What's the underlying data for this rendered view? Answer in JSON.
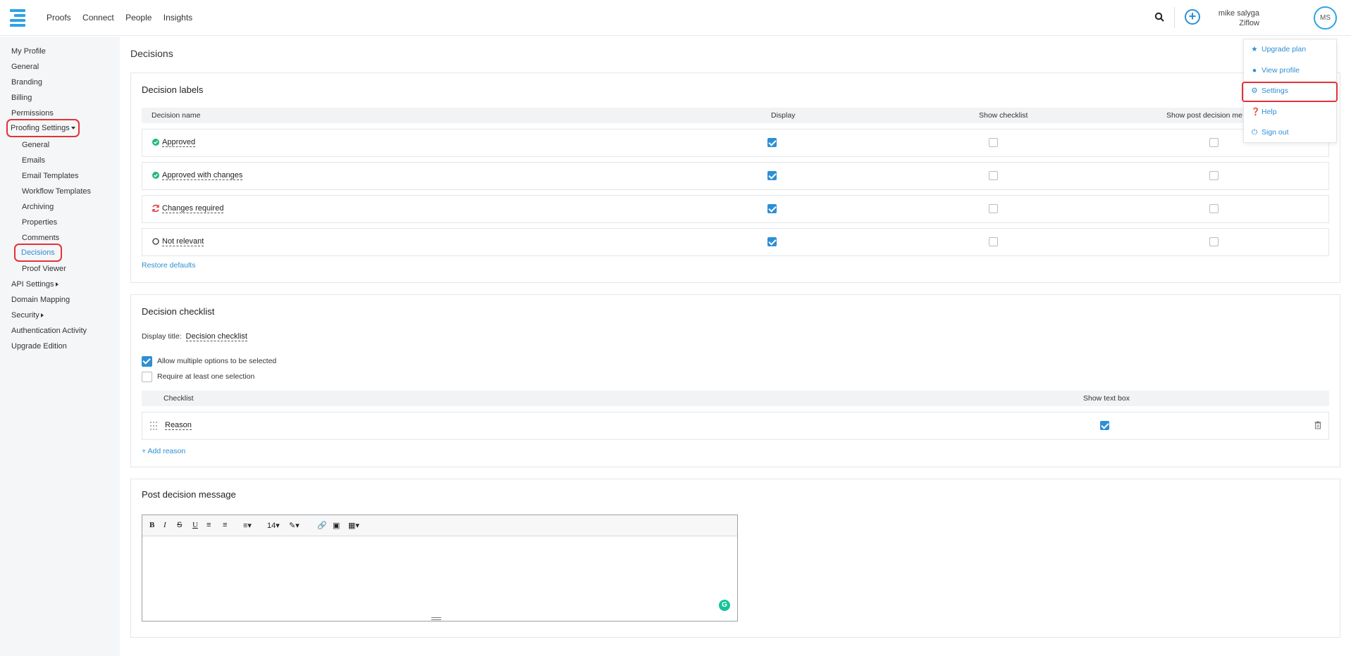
{
  "topnav": {
    "items": [
      "Proofs",
      "Connect",
      "People",
      "Insights"
    ]
  },
  "user": {
    "name": "mike salyga",
    "org": "Ziflow",
    "initials": "MS"
  },
  "sidebar": {
    "items": [
      {
        "label": "My Profile"
      },
      {
        "label": "General"
      },
      {
        "label": "Branding"
      },
      {
        "label": "Billing"
      },
      {
        "label": "Permissions"
      },
      {
        "label": "Proofing Settings"
      },
      {
        "label": "General"
      },
      {
        "label": "Emails"
      },
      {
        "label": "Email Templates"
      },
      {
        "label": "Workflow Templates"
      },
      {
        "label": "Archiving"
      },
      {
        "label": "Properties"
      },
      {
        "label": "Comments"
      },
      {
        "label": "Decisions"
      },
      {
        "label": "Proof Viewer"
      },
      {
        "label": "API Settings"
      },
      {
        "label": "Domain Mapping"
      },
      {
        "label": "Security"
      },
      {
        "label": "Authentication Activity"
      },
      {
        "label": "Upgrade Edition"
      }
    ]
  },
  "page": {
    "title": "Decisions"
  },
  "labels": {
    "title": "Decision labels",
    "columns": [
      "Decision name",
      "Display",
      "Show checklist",
      "Show post decision me"
    ],
    "rows": [
      {
        "name": "Approved",
        "display": true,
        "checklist": false,
        "post": false
      },
      {
        "name": "Approved with changes",
        "display": true,
        "checklist": false,
        "post": false
      },
      {
        "name": "Changes required",
        "display": true,
        "checklist": false,
        "post": false
      },
      {
        "name": "Not relevant",
        "display": true,
        "checklist": false,
        "post": false
      }
    ],
    "restore": "Restore defaults"
  },
  "checklist": {
    "title": "Decision checklist",
    "display_title_label": "Display title:",
    "display_title_value": "Decision checklist",
    "allow_multiple": "Allow multiple options to be selected",
    "require_one": "Require at least one selection",
    "columns": [
      "Checklist",
      "Show text box"
    ],
    "rows": [
      {
        "name": "Reason",
        "textbox": true
      }
    ],
    "add": "+ Add reason"
  },
  "post": {
    "title": "Post decision message",
    "font_size": "14"
  },
  "menu": {
    "items": [
      "Upgrade plan",
      "View profile",
      "Settings",
      "Help",
      "Sign out"
    ]
  },
  "colors": {
    "accent": "#2d8fd5",
    "highlight": "#e53238",
    "approved": "#1fb97a",
    "changes": "#e53238"
  }
}
